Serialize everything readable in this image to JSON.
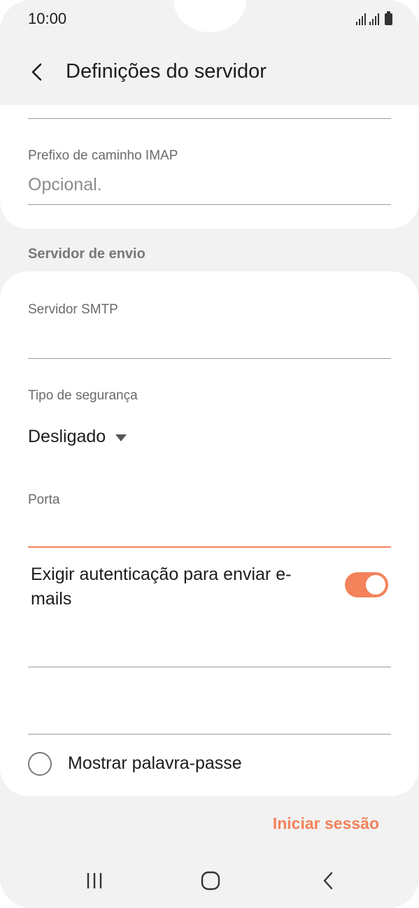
{
  "status_bar": {
    "time": "10:00",
    "icons": [
      "signal-sim1-icon",
      "signal-sim2-icon",
      "battery-icon"
    ]
  },
  "header": {
    "title": "Definições do servidor",
    "back_icon": "chevron-left-icon"
  },
  "incoming": {
    "imap_prefix_label": "Prefixo de caminho IMAP",
    "imap_prefix_placeholder": "Opcional."
  },
  "outgoing": {
    "section_title": "Servidor de envio",
    "smtp_label": "Servidor SMTP",
    "smtp_value": "",
    "security_label": "Tipo de segurança",
    "security_value": "Desligado",
    "port_label": "Porta",
    "port_value": "",
    "auth_label": "Exigir autenticação para enviar e-mails",
    "auth_enabled": true,
    "username_value": "",
    "password_value": "",
    "show_password_label": "Mostrar palavra-passe",
    "show_password_checked": false
  },
  "actions": {
    "sign_in_label": "Iniciar sessão"
  },
  "nav_bar": {
    "icons": [
      "recent-apps-icon",
      "home-icon",
      "back-icon"
    ]
  },
  "colors": {
    "accent": "#f4825a",
    "background": "#f2f2f2",
    "card": "#ffffff"
  }
}
